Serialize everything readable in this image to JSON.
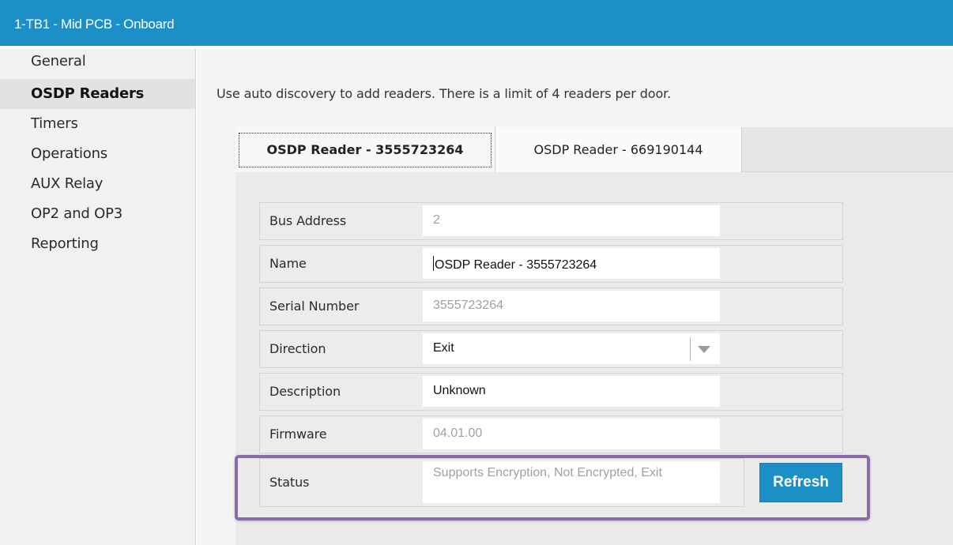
{
  "window": {
    "title": "1-TB1 - Mid PCB - Onboard"
  },
  "sidebar": {
    "items": [
      {
        "label": "General"
      },
      {
        "label": "OSDP Readers",
        "active": true
      },
      {
        "label": "Timers"
      },
      {
        "label": "Operations"
      },
      {
        "label": "AUX Relay"
      },
      {
        "label": "OP2 and OP3"
      },
      {
        "label": "Reporting"
      }
    ]
  },
  "main": {
    "hint": "Use auto discovery to add readers. There is a limit of 4 readers per door.",
    "tabs": [
      {
        "label": "OSDP Reader - 3555723264",
        "active": true
      },
      {
        "label": "OSDP Reader - 669190144"
      }
    ],
    "fields": {
      "bus_address": {
        "label": "Bus Address",
        "value": "2"
      },
      "name": {
        "label": "Name",
        "value": "OSDP Reader - 3555723264"
      },
      "serial_number": {
        "label": "Serial Number",
        "value": "3555723264"
      },
      "direction": {
        "label": "Direction",
        "value": "Exit"
      },
      "description": {
        "label": "Description",
        "value": "Unknown"
      },
      "firmware": {
        "label": "Firmware",
        "value": "04.01.00"
      },
      "status": {
        "label": "Status",
        "value": "Supports Encryption, Not Encrypted, Exit"
      }
    },
    "refresh_label": "Refresh"
  },
  "colors": {
    "accent": "#1c8fc7",
    "highlight": "#8a6aa8"
  }
}
